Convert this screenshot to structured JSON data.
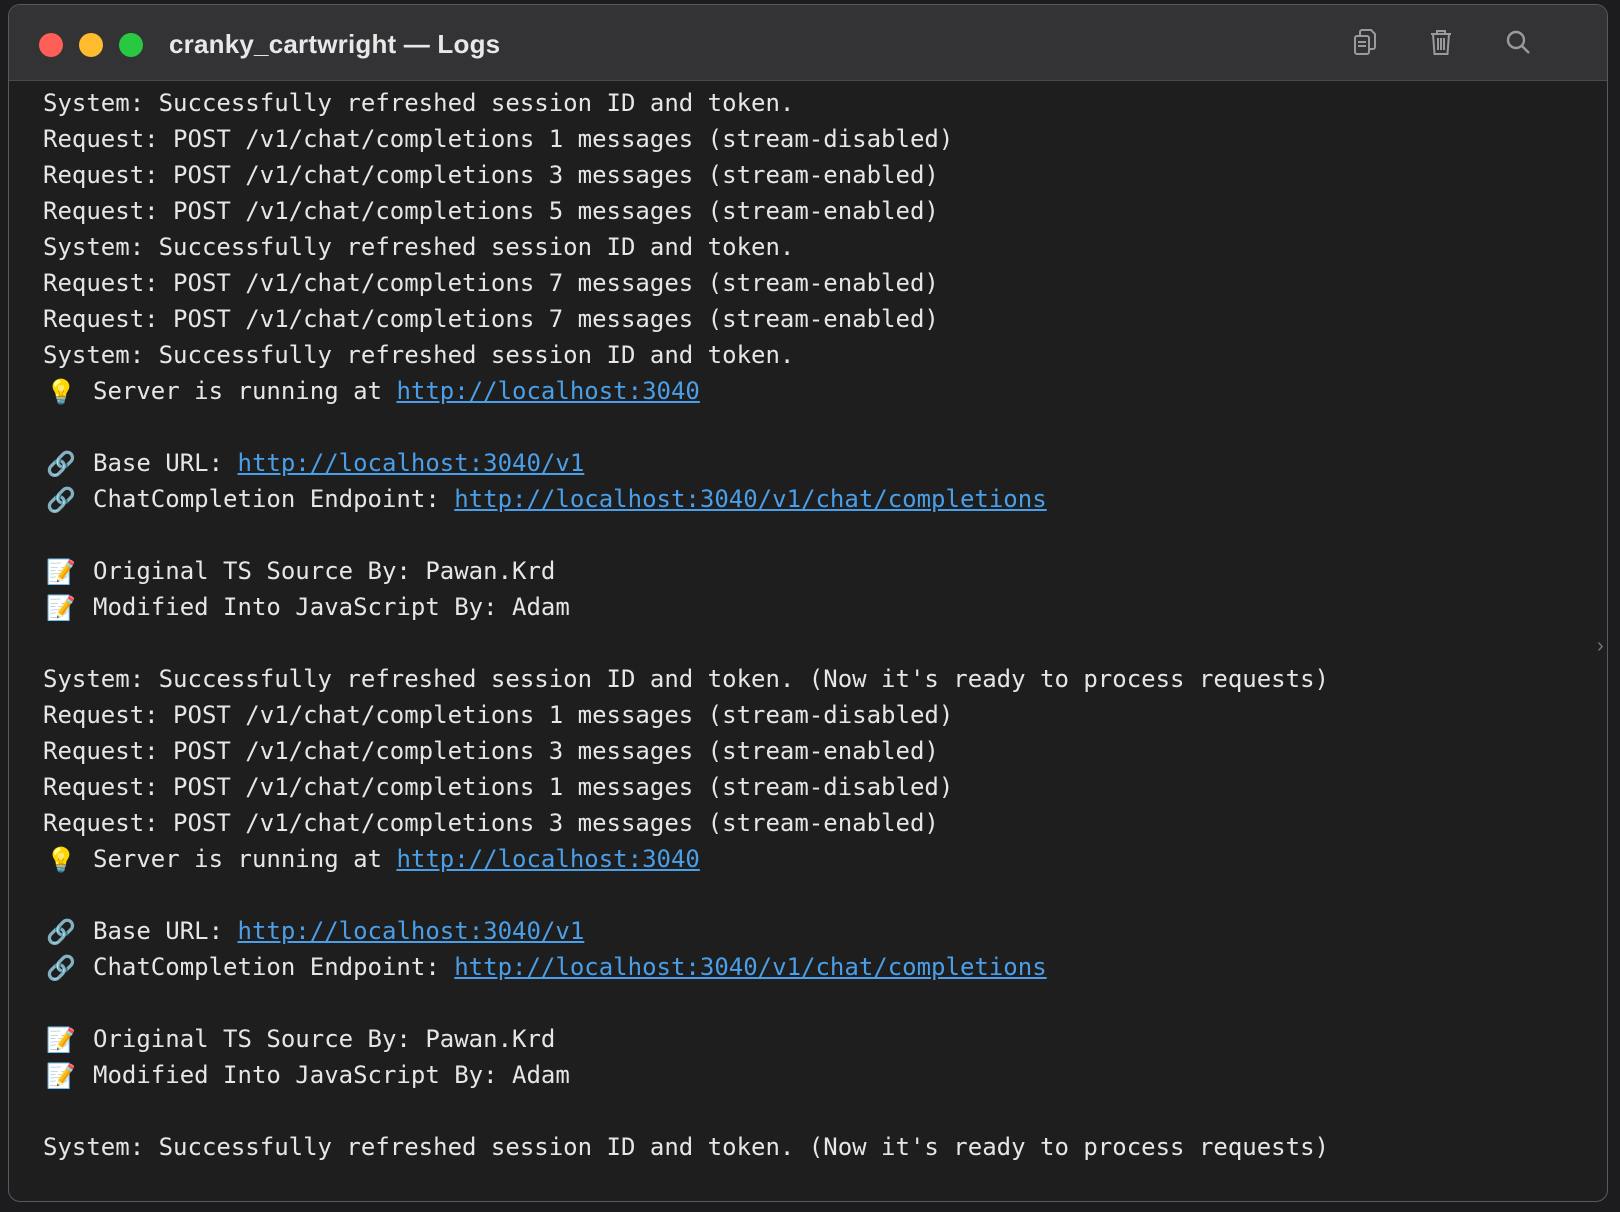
{
  "window": {
    "title": "cranky_cartwright — Logs"
  },
  "toolbar": {
    "copy_icon": "copy-icon",
    "trash_icon": "trash-icon",
    "search_icon": "search-icon"
  },
  "colors": {
    "link": "#4a9fe8",
    "text": "#e6e6e6",
    "background": "#1e1e1e"
  },
  "logs": [
    {
      "text": "System: Successfully refreshed session ID and token."
    },
    {
      "text": "Request: POST /v1/chat/completions 1 messages (stream-disabled)"
    },
    {
      "text": "Request: POST /v1/chat/completions 3 messages (stream-enabled)"
    },
    {
      "text": "Request: POST /v1/chat/completions 5 messages (stream-enabled)"
    },
    {
      "text": "System: Successfully refreshed session ID and token."
    },
    {
      "text": "Request: POST /v1/chat/completions 7 messages (stream-enabled)"
    },
    {
      "text": "Request: POST /v1/chat/completions 7 messages (stream-enabled)"
    },
    {
      "text": "System: Successfully refreshed session ID and token."
    },
    {
      "icon": "💡",
      "icon_name": "lightbulb-icon",
      "text": "Server is running at ",
      "link": "http://localhost:3040"
    },
    {
      "blank": true
    },
    {
      "icon": "🔗",
      "icon_name": "link-icon",
      "text": "Base URL: ",
      "link": "http://localhost:3040/v1"
    },
    {
      "icon": "🔗",
      "icon_name": "link-icon",
      "text": "ChatCompletion Endpoint: ",
      "link": "http://localhost:3040/v1/chat/completions"
    },
    {
      "blank": true
    },
    {
      "icon": "📝",
      "icon_name": "memo-icon",
      "text": "Original TS Source By: Pawan.Krd"
    },
    {
      "icon": "📝",
      "icon_name": "memo-icon",
      "text": "Modified Into JavaScript By: Adam"
    },
    {
      "blank": true
    },
    {
      "text": "System: Successfully refreshed session ID and token. (Now it's ready to process requests)"
    },
    {
      "text": "Request: POST /v1/chat/completions 1 messages (stream-disabled)"
    },
    {
      "text": "Request: POST /v1/chat/completions 3 messages (stream-enabled)"
    },
    {
      "text": "Request: POST /v1/chat/completions 1 messages (stream-disabled)"
    },
    {
      "text": "Request: POST /v1/chat/completions 3 messages (stream-enabled)"
    },
    {
      "icon": "💡",
      "icon_name": "lightbulb-icon",
      "text": "Server is running at ",
      "link": "http://localhost:3040"
    },
    {
      "blank": true
    },
    {
      "icon": "🔗",
      "icon_name": "link-icon",
      "text": "Base URL: ",
      "link": "http://localhost:3040/v1"
    },
    {
      "icon": "🔗",
      "icon_name": "link-icon",
      "text": "ChatCompletion Endpoint: ",
      "link": "http://localhost:3040/v1/chat/completions"
    },
    {
      "blank": true
    },
    {
      "icon": "📝",
      "icon_name": "memo-icon",
      "text": "Original TS Source By: Pawan.Krd"
    },
    {
      "icon": "📝",
      "icon_name": "memo-icon",
      "text": "Modified Into JavaScript By: Adam"
    },
    {
      "blank": true
    },
    {
      "text": "System: Successfully refreshed session ID and token. (Now it's ready to process requests)"
    }
  ]
}
